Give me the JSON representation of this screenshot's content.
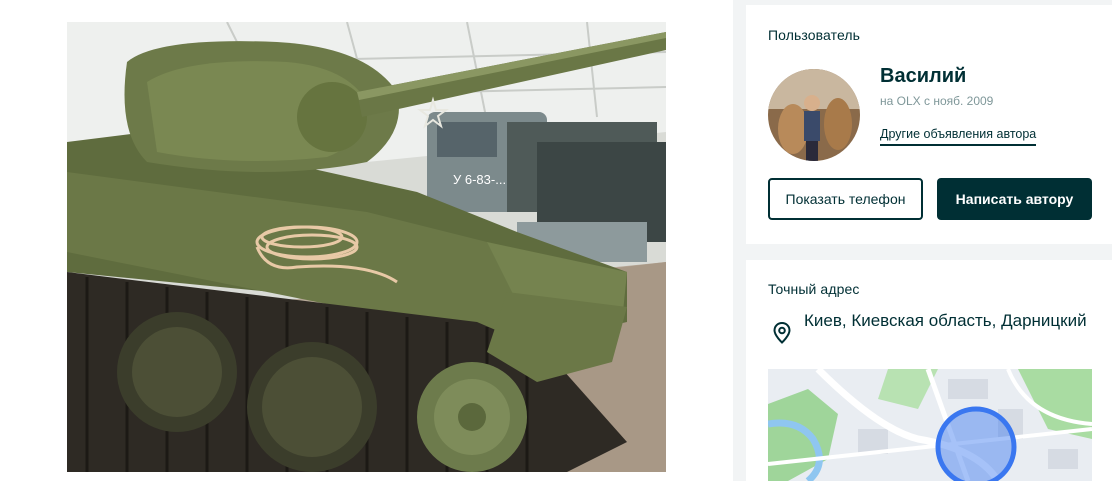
{
  "listing": {
    "photo": {
      "subject": "tank-photo"
    }
  },
  "user_card": {
    "title": "Пользователь",
    "name": "Василий",
    "since": "на OLX с нояб. 2009",
    "other_ads_link": "Другие объявления автора",
    "show_phone_button": "Показать телефон",
    "write_button": "Написать автору"
  },
  "address_card": {
    "title": "Точный адрес",
    "address": "Киев, Киевская область, Дарницкий"
  },
  "photo_text": {
    "truck_plate": "У 6-83-..."
  },
  "colors": {
    "brand_dark": "#002f34",
    "muted": "#7f9799",
    "page_bg": "#f2f4f5",
    "map_circle": "#3a77f0"
  },
  "icons": [
    "location-pin-icon"
  ]
}
